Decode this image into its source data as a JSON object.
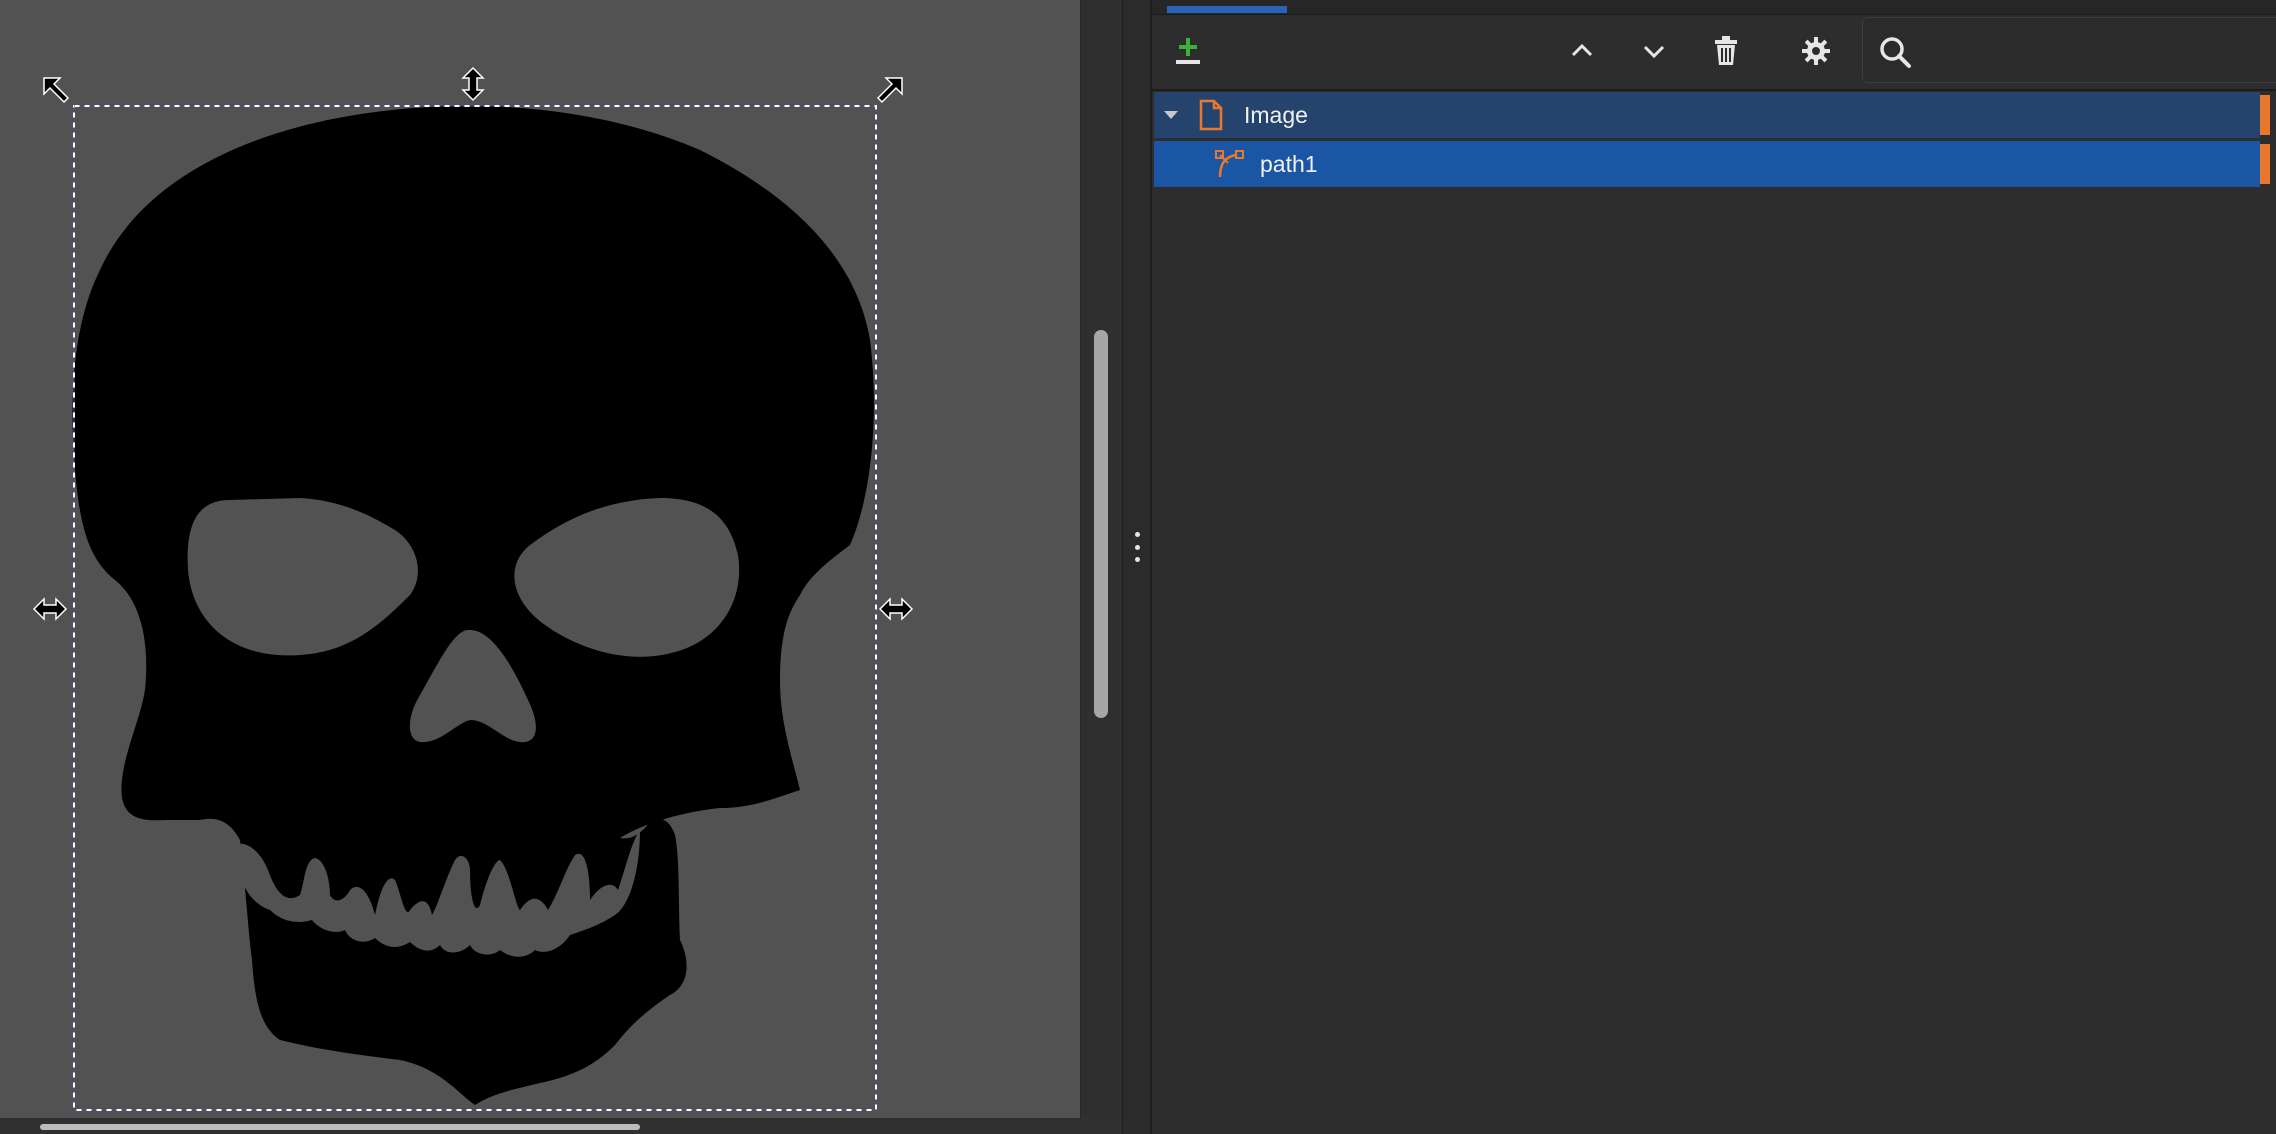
{
  "panel": {
    "toolbar": {
      "add_icon": "add-layer-icon",
      "raise_icon": "chevron-up-icon",
      "lower_icon": "chevron-down-icon",
      "delete_icon": "trash-icon",
      "settings_icon": "gear-icon",
      "search_icon": "search-icon",
      "search_value": ""
    },
    "layers": [
      {
        "label": "Image",
        "icon": "document-icon",
        "expanded": true
      },
      {
        "label": "path1",
        "icon": "path-icon"
      }
    ]
  },
  "colors": {
    "canvas_bg": "#525252",
    "panel_bg": "#2d2d2d",
    "row_selected": "#1b56a4",
    "row_parent": "#24446e",
    "accent_orange": "#e8782e",
    "tab_indicator": "#2a64b8"
  }
}
